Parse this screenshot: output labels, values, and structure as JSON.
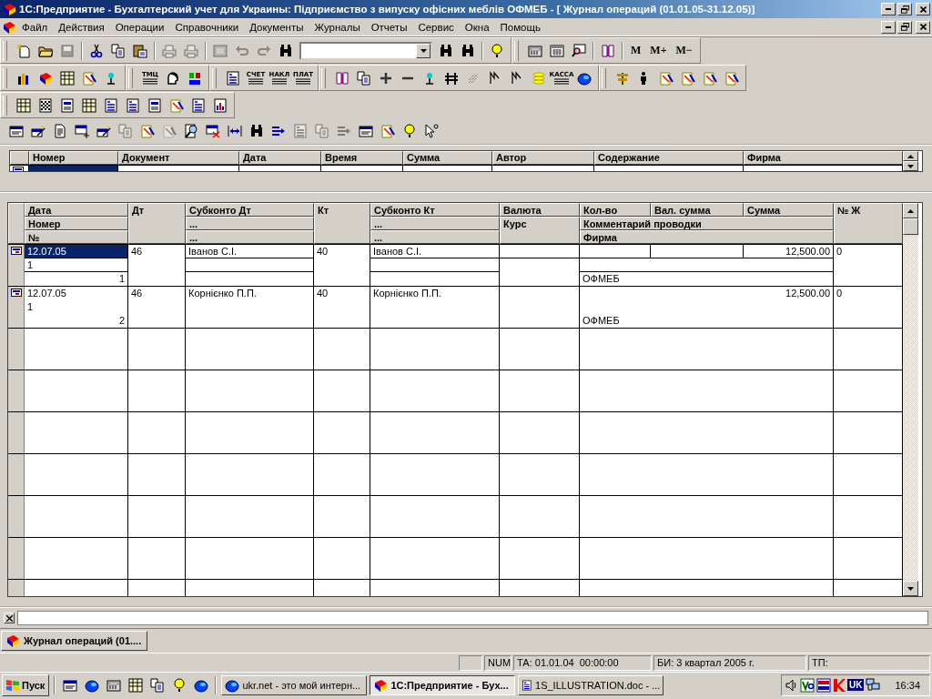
{
  "window": {
    "title": "1С:Предприятие - Бухгалтерский учет для Украины: Підприємство з випуску офісних меблів ОФМЕБ - [ Журнал операций (01.01.05-31.12.05)]"
  },
  "menu": [
    {
      "label": "Файл"
    },
    {
      "label": "Действия"
    },
    {
      "label": "Операции"
    },
    {
      "label": "Справочники"
    },
    {
      "label": "Документы"
    },
    {
      "label": "Журналы"
    },
    {
      "label": "Отчеты"
    },
    {
      "label": "Сервис"
    },
    {
      "label": "Окна"
    },
    {
      "label": "Помощь"
    }
  ],
  "toolbar_rows": [
    {
      "toolbars": [
        {
          "items": [
            {
              "kind": "icon",
              "disabled": false
            },
            {
              "kind": "icon",
              "disabled": false
            },
            {
              "kind": "icon",
              "disabled": true
            },
            {
              "kind": "separator"
            },
            {
              "kind": "icon",
              "disabled": false
            },
            {
              "kind": "icon",
              "disabled": false
            },
            {
              "kind": "icon",
              "disabled": false
            },
            {
              "kind": "separator"
            },
            {
              "kind": "icon",
              "disabled": true
            },
            {
              "kind": "icon",
              "disabled": true
            },
            {
              "kind": "separator"
            },
            {
              "kind": "icon",
              "disabled": true
            },
            {
              "kind": "icon",
              "disabled": true
            },
            {
              "kind": "icon",
              "disabled": true
            },
            {
              "kind": "icon",
              "disabled": false
            },
            {
              "kind": "combo"
            },
            {
              "kind": "icon",
              "disabled": false
            },
            {
              "kind": "icon",
              "disabled": false
            },
            {
              "kind": "separator"
            },
            {
              "kind": "icon",
              "disabled": false
            }
          ]
        },
        {
          "items": [
            {
              "kind": "icon",
              "disabled": false
            },
            {
              "kind": "icon",
              "disabled": false
            },
            {
              "kind": "icon",
              "disabled": false
            },
            {
              "kind": "separator"
            },
            {
              "kind": "icon",
              "disabled": false
            },
            {
              "kind": "separator"
            },
            {
              "kind": "text",
              "label": "M"
            },
            {
              "kind": "text",
              "label": "M+"
            },
            {
              "kind": "text",
              "label": "M−"
            }
          ]
        }
      ]
    },
    {
      "toolbars": [
        {
          "items": [
            {
              "kind": "icon",
              "disabled": false
            },
            {
              "kind": "icon",
              "disabled": false
            },
            {
              "kind": "icon",
              "disabled": false
            },
            {
              "kind": "icon",
              "disabled": false
            },
            {
              "kind": "icon",
              "disabled": false
            }
          ]
        },
        {
          "items": [
            {
              "kind": "labeled",
              "label": "ТМЦ"
            },
            {
              "kind": "icon",
              "disabled": false
            },
            {
              "kind": "icon",
              "disabled": false
            }
          ]
        },
        {
          "items": [
            {
              "kind": "icon",
              "disabled": false
            },
            {
              "kind": "labeled",
              "label": "СЧЕТ"
            },
            {
              "kind": "labeled",
              "label": "НАКЛ"
            },
            {
              "kind": "labeled",
              "label": "ПЛАТ"
            }
          ]
        },
        {
          "items": [
            {
              "kind": "icon",
              "disabled": false
            },
            {
              "kind": "icon",
              "disabled": false
            },
            {
              "kind": "icon",
              "disabled": false
            },
            {
              "kind": "icon",
              "disabled": false
            },
            {
              "kind": "icon",
              "disabled": false
            },
            {
              "kind": "icon",
              "disabled": false
            },
            {
              "kind": "icon",
              "disabled": false
            },
            {
              "kind": "icon",
              "disabled": false
            },
            {
              "kind": "icon",
              "disabled": false
            },
            {
              "kind": "icon",
              "disabled": false
            },
            {
              "kind": "labeled",
              "label": "КАССА"
            },
            {
              "kind": "icon",
              "disabled": false
            }
          ]
        },
        {
          "items": [
            {
              "kind": "icon",
              "disabled": false
            },
            {
              "kind": "icon",
              "disabled": false
            },
            {
              "kind": "icon",
              "disabled": false
            },
            {
              "kind": "icon",
              "disabled": false
            },
            {
              "kind": "icon",
              "disabled": false
            },
            {
              "kind": "icon",
              "disabled": false
            }
          ]
        }
      ]
    },
    {
      "toolbars": [
        {
          "items": [
            {
              "kind": "icon",
              "disabled": false
            },
            {
              "kind": "icon",
              "disabled": false
            },
            {
              "kind": "icon",
              "disabled": false
            },
            {
              "kind": "icon",
              "disabled": false
            },
            {
              "kind": "icon",
              "disabled": false
            },
            {
              "kind": "icon",
              "disabled": false
            },
            {
              "kind": "icon",
              "disabled": false
            },
            {
              "kind": "icon",
              "disabled": false
            },
            {
              "kind": "icon",
              "disabled": false
            },
            {
              "kind": "icon",
              "disabled": false
            }
          ]
        }
      ]
    }
  ],
  "form_toolbar": [
    {
      "kind": "icon",
      "disabled": false
    },
    {
      "kind": "icon",
      "disabled": false
    },
    {
      "kind": "icon",
      "disabled": false
    },
    {
      "kind": "icon",
      "disabled": false
    },
    {
      "kind": "icon",
      "disabled": false
    },
    {
      "kind": "icon",
      "disabled": true
    },
    {
      "kind": "icon",
      "disabled": false
    },
    {
      "kind": "icon",
      "disabled": true
    },
    {
      "kind": "icon",
      "disabled": false
    },
    {
      "kind": "icon",
      "disabled": false
    },
    {
      "kind": "icon",
      "disabled": false
    },
    {
      "kind": "icon",
      "disabled": false
    },
    {
      "kind": "icon",
      "disabled": false
    },
    {
      "kind": "icon",
      "disabled": true
    },
    {
      "kind": "icon",
      "disabled": true
    },
    {
      "kind": "icon",
      "disabled": true
    },
    {
      "kind": "icon",
      "disabled": false
    },
    {
      "kind": "icon",
      "disabled": false
    },
    {
      "kind": "icon",
      "disabled": false
    },
    {
      "kind": "icon",
      "disabled": false
    }
  ],
  "documents_table": {
    "columns": [
      "Номер",
      "Документ",
      "Дата",
      "Время",
      "Сумма",
      "Автор",
      "Содержание",
      "Фирма"
    ]
  },
  "entries_table": {
    "header": {
      "date": "Дата",
      "number": "Номер",
      "line_no": "№",
      "dt": "Дт",
      "subconto_dt": [
        "Субконто Дт",
        "...",
        "..."
      ],
      "kt": "Кт",
      "subconto_kt": [
        "Субконто Кт",
        "...",
        "..."
      ],
      "currency": "Валюта",
      "rate": "Курс",
      "quantity": "Кол-во",
      "currency_sum": "Вал. сумма",
      "sum": "Сумма",
      "comment": "Комментарий проводки",
      "firm": "Фирма",
      "journal_no": "№ Ж"
    },
    "records": [
      {
        "selected": true,
        "date": "12.07.05",
        "number": "1",
        "line_no": "1",
        "dt": "46",
        "subconto_dt": "Іванов С.І.",
        "kt": "40",
        "subconto_kt": "Іванов С.І.",
        "sum": "12,500.00",
        "firm": "ОФМЕБ",
        "journal_no": "0"
      },
      {
        "selected": false,
        "date": "12.07.05",
        "number": "1",
        "line_no": "2",
        "dt": "46",
        "subconto_dt": "Корнієнко П.П.",
        "kt": "40",
        "subconto_kt": "Корнієнко П.П.",
        "sum": "12,500.00",
        "firm": "ОФМЕБ",
        "journal_no": "0"
      }
    ]
  },
  "window_tabs": [
    {
      "label": "Журнал операций (01....",
      "selected": true
    }
  ],
  "status_bar": [
    "NUM",
    "ТА: 01.01.04  00:00:00",
    "БИ: 3 квартал 2005 г.",
    "ТП:"
  ],
  "taskbar": {
    "start": "Пуск",
    "tasks": [
      {
        "label": "ukr.net - это мой интерн...",
        "selected": false
      },
      {
        "label": "1С:Предприятие - Бух...",
        "selected": true
      },
      {
        "label": "1S_ILLUSTRATION.doc - ...",
        "selected": false
      }
    ],
    "language": "UK",
    "clock": "16:34"
  }
}
